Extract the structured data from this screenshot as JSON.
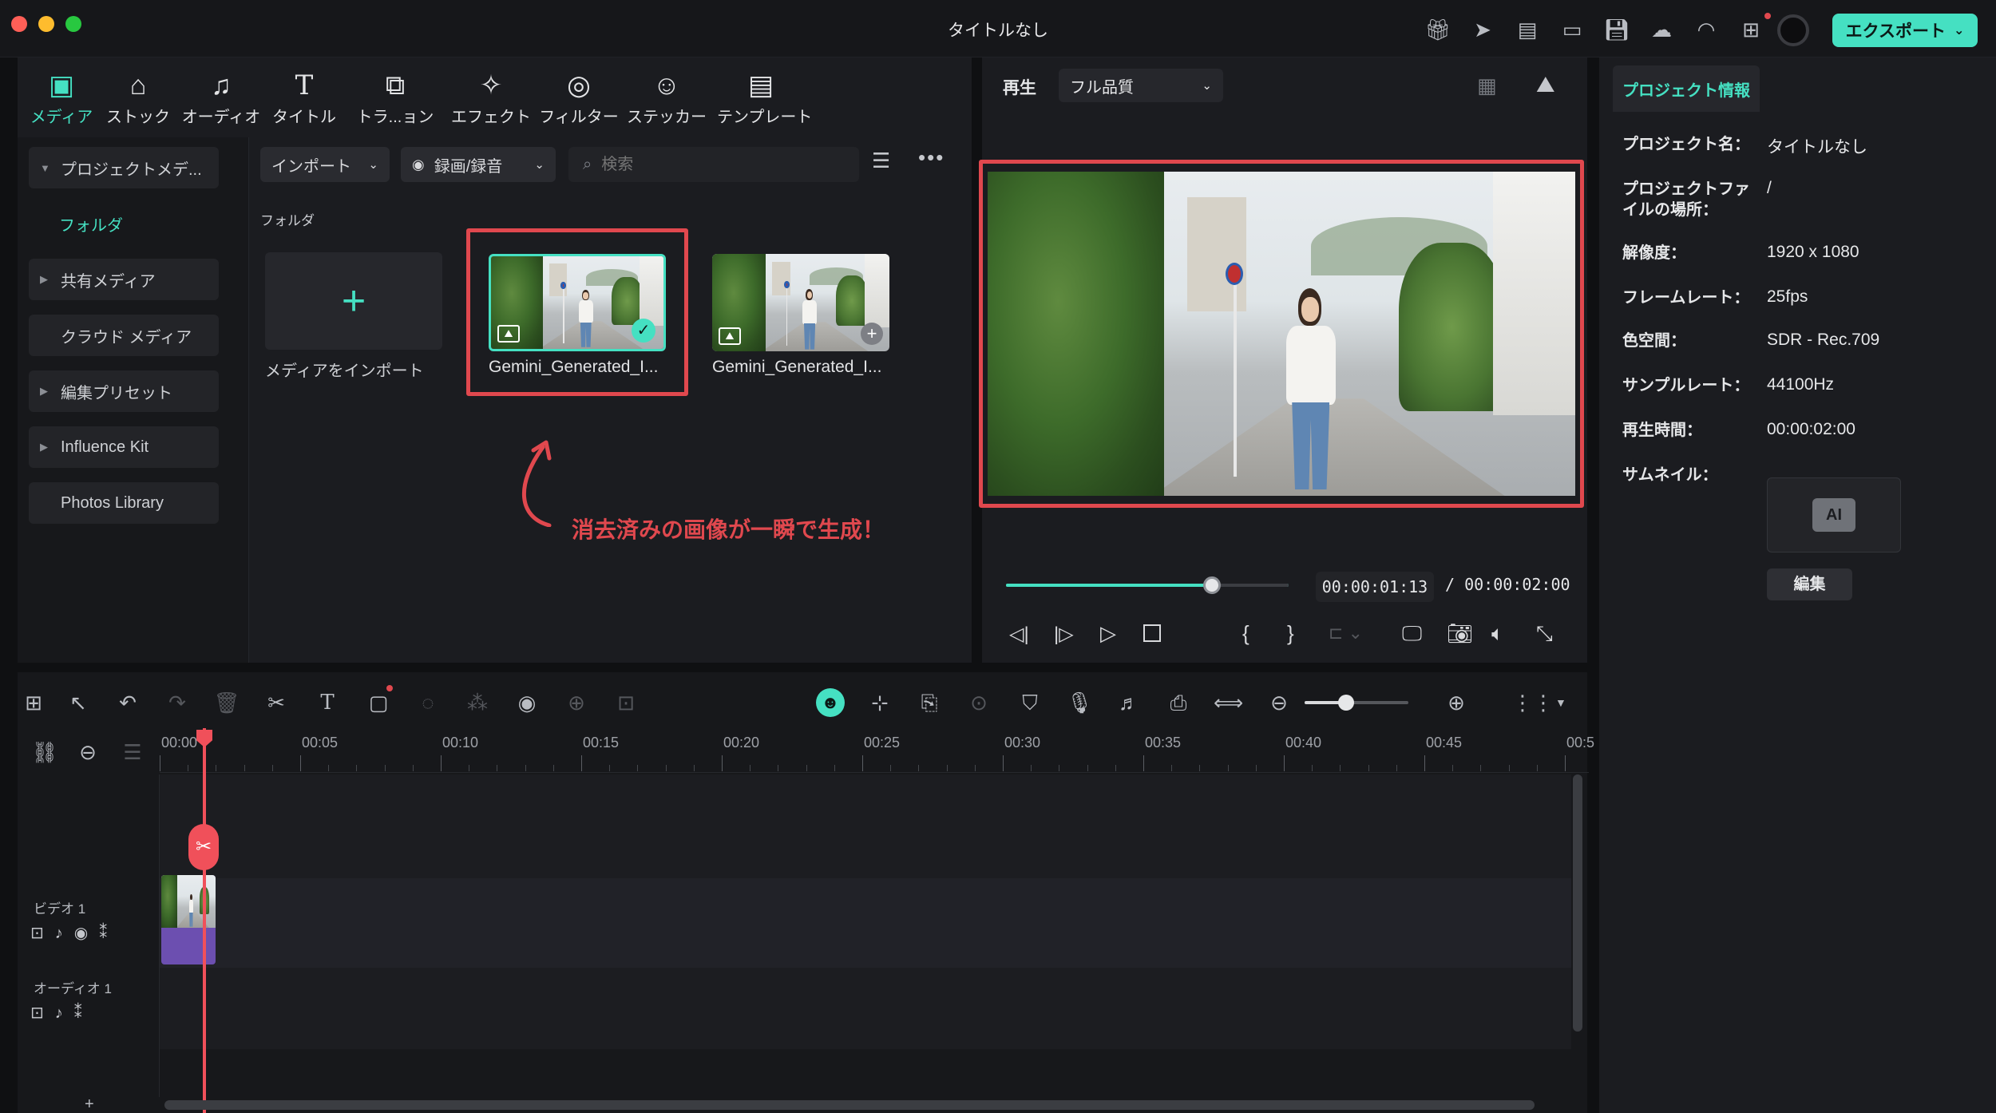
{
  "window": {
    "title": "タイトルなし",
    "export_label": "エクスポート"
  },
  "media_tabs": [
    {
      "label": "メディア",
      "icon": "media-icon"
    },
    {
      "label": "ストック",
      "icon": "stock-icon"
    },
    {
      "label": "オーディオ",
      "icon": "audio-icon"
    },
    {
      "label": "タイトル",
      "icon": "title-icon"
    },
    {
      "label": "トラ...ョン",
      "icon": "transition-icon"
    },
    {
      "label": "エフェクト",
      "icon": "effect-icon"
    },
    {
      "label": "フィルター",
      "icon": "filter-icon"
    },
    {
      "label": "ステッカー",
      "icon": "sticker-icon"
    },
    {
      "label": "テンプレート",
      "icon": "template-icon"
    }
  ],
  "sidebar": {
    "items": [
      {
        "label": "プロジェクトメデ..."
      },
      {
        "label": "フォルダ"
      },
      {
        "label": "共有メディア"
      },
      {
        "label": "クラウド メディア"
      },
      {
        "label": "編集プリセット"
      },
      {
        "label": "Influence Kit"
      },
      {
        "label": "Photos Library"
      }
    ]
  },
  "media_toolbar": {
    "import_label": "インポート",
    "record_label": "録画/録音",
    "search_placeholder": "検索"
  },
  "media_grid": {
    "section_label": "フォルダ",
    "import_tile_label": "メディアをインポート",
    "items": [
      {
        "label": "Gemini_Generated_I...",
        "selected": true
      },
      {
        "label": "Gemini_Generated_I...",
        "selected": false
      }
    ]
  },
  "annotation": {
    "text": "消去済みの画像が一瞬で生成！",
    "color": "#e0484e"
  },
  "preview": {
    "tab_label": "再生",
    "quality_label": "フル品質",
    "current_time": "00:00:01:13",
    "total_time": "/ 00:00:02:00",
    "progress": 0.73
  },
  "project_info": {
    "tab_label": "プロジェクト情報",
    "rows": [
      {
        "key": "プロジェクト名：",
        "value": "タイトルなし"
      },
      {
        "key": "プロジェクトファイルの場所：",
        "value": "/"
      },
      {
        "key": "解像度：",
        "value": "1920 x 1080"
      },
      {
        "key": "フレームレート：",
        "value": "25fps"
      },
      {
        "key": "色空間：",
        "value": "SDR - Rec.709"
      },
      {
        "key": "サンプルレート：",
        "value": "44100Hz"
      },
      {
        "key": "再生時間：",
        "value": "00:00:02:00"
      },
      {
        "key": "サムネイル：",
        "value": ""
      }
    ],
    "edit_label": "編集"
  },
  "timeline": {
    "ruler": [
      "00:00",
      "00:05",
      "00:10",
      "00:15",
      "00:20",
      "00:25",
      "00:30",
      "00:35",
      "00:40",
      "00:45",
      "00:5"
    ],
    "tracks": [
      {
        "label": "ビデオ 1"
      },
      {
        "label": "オーディオ 1"
      }
    ],
    "add_track_symbol": "+",
    "zoom_level": 0.4
  },
  "colors": {
    "accent": "#45e0c2",
    "highlight": "#e0484e",
    "playhead": "#f0505a"
  }
}
